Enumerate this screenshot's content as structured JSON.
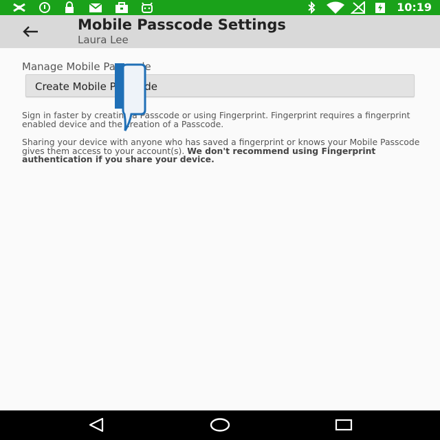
{
  "status_bar": {
    "time": "10:19",
    "color": "#1aa21a",
    "icons": [
      "no-location-icon",
      "alert-circle-icon",
      "lock-icon",
      "mail-icon",
      "briefcase-icon",
      "android-icon",
      "bluetooth-icon",
      "wifi-icon",
      "signal-icon",
      "battery-charging-icon"
    ]
  },
  "app_bar": {
    "title": "Mobile Passcode Settings",
    "subtitle": "Laura Lee",
    "back_icon": "arrow-left-icon"
  },
  "content": {
    "section_label": "Manage Mobile Passcode",
    "create_button": "Create Mobile Passcode",
    "paragraph1": "Sign in faster by creating a Passcode or using Fingerprint. Fingerprint requires a fingerprint enabled device and the creation of a Passcode.",
    "paragraph2_normal": "Sharing your device with anyone who has saved a fingerprint or knows your Mobile Passcode gives them access to your account(s). ",
    "paragraph2_bold": "We don't recommend using Fingerprint authentication if you share your device."
  },
  "nav_bar": {
    "icons": [
      "back-triangle-icon",
      "home-circle-icon",
      "recents-square-icon"
    ]
  }
}
